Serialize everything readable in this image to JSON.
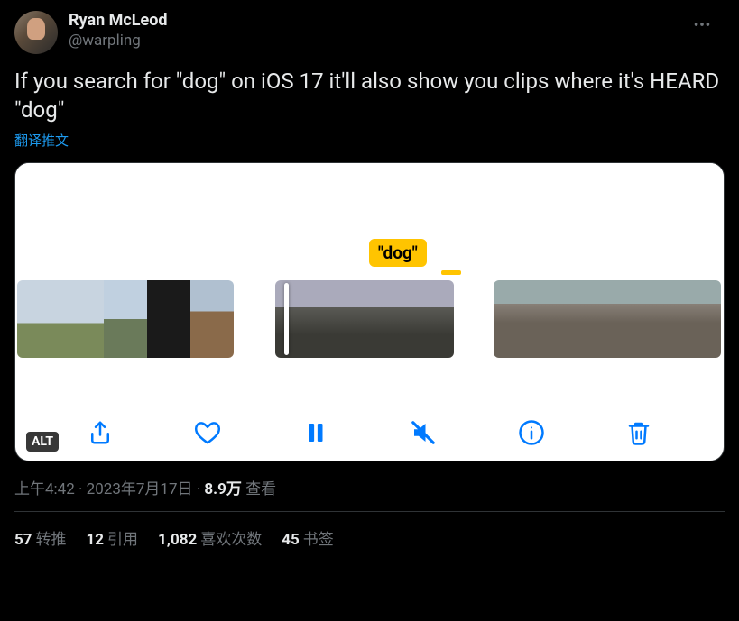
{
  "author": {
    "display_name": "Ryan McLeod",
    "handle": "@warpling"
  },
  "body": "If you search for \"dog\" on iOS 17 it'll also show you clips where it's HEARD \"dog\"",
  "translate_label": "翻译推文",
  "media": {
    "badge_text": "\"dog\"",
    "alt_label": "ALT"
  },
  "meta": {
    "time": "上午4:42",
    "sep": " · ",
    "date": "2023年7月17日",
    "views_count": "8.9万",
    "views_label": "查看"
  },
  "stats": {
    "retweets": {
      "count": "57",
      "label": "转推"
    },
    "quotes": {
      "count": "12",
      "label": "引用"
    },
    "likes": {
      "count": "1,082",
      "label": "喜欢次数"
    },
    "bookmarks": {
      "count": "45",
      "label": "书签"
    }
  }
}
